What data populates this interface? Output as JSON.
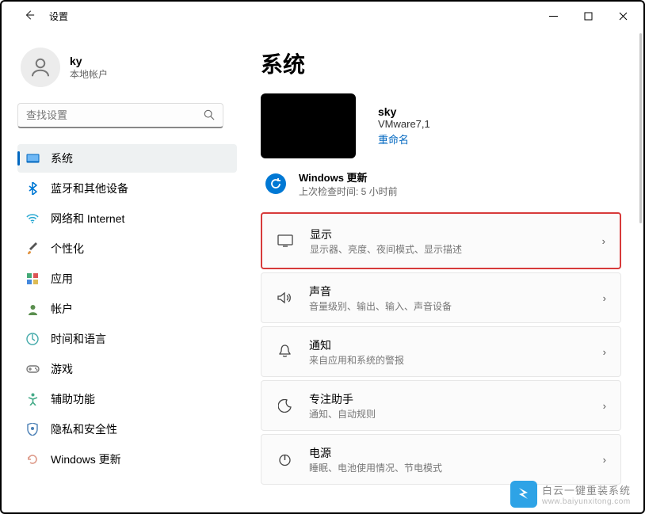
{
  "app_title": "设置",
  "user": {
    "name": "ky",
    "sub": "本地帐户"
  },
  "search_placeholder": "查找设置",
  "nav": [
    {
      "label": "系统",
      "selected": true
    },
    {
      "label": "蓝牙和其他设备"
    },
    {
      "label": "网络和 Internet"
    },
    {
      "label": "个性化"
    },
    {
      "label": "应用"
    },
    {
      "label": "帐户"
    },
    {
      "label": "时间和语言"
    },
    {
      "label": "游戏"
    },
    {
      "label": "辅助功能"
    },
    {
      "label": "隐私和安全性"
    },
    {
      "label": "Windows 更新"
    }
  ],
  "page_title": "系统",
  "device": {
    "name": "sky",
    "model": "VMware7,1",
    "rename": "重命名"
  },
  "update": {
    "title": "Windows 更新",
    "sub": "上次检查时间: 5 小时前"
  },
  "tiles": [
    {
      "title": "显示",
      "sub": "显示器、亮度、夜间模式、显示描述",
      "hl": true
    },
    {
      "title": "声音",
      "sub": "音量级别、输出、输入、声音设备"
    },
    {
      "title": "通知",
      "sub": "来自应用和系统的警报"
    },
    {
      "title": "专注助手",
      "sub": "通知、自动规则"
    },
    {
      "title": "电源",
      "sub": "睡眠、电池使用情况、节电模式"
    }
  ],
  "watermark": {
    "line1": "白云一键重装系统",
    "line2": "www.baiyunxitong.com"
  }
}
